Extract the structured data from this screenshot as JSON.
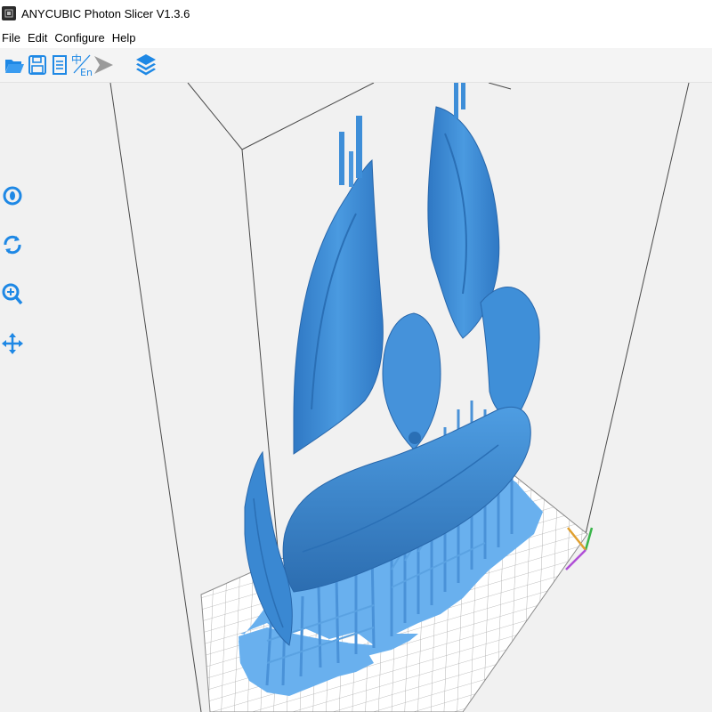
{
  "window": {
    "title": "ANYCUBIC Photon Slicer V1.3.6"
  },
  "menu": {
    "items": [
      {
        "label": "File"
      },
      {
        "label": "Edit"
      },
      {
        "label": "Configure"
      },
      {
        "label": "Help"
      }
    ]
  },
  "toolbar": {
    "buttons": [
      {
        "icon": "folder-open-icon"
      },
      {
        "icon": "save-icon"
      },
      {
        "icon": "document-icon"
      },
      {
        "icon": "language-icon",
        "label": "En"
      },
      {
        "icon": "slice-play-icon"
      },
      {
        "icon": "layers-icon"
      }
    ]
  },
  "view_controls": {
    "buttons": [
      {
        "icon": "eye-icon"
      },
      {
        "icon": "rotate-icon"
      },
      {
        "icon": "zoom-icon"
      },
      {
        "icon": "pan-move-icon"
      }
    ]
  },
  "colors": {
    "accent": "#1e88e5",
    "model": "#3e8ed8",
    "model_shadow": "#2a6fb5",
    "model_light": "#6fb0ea",
    "raft": "#6ab1ef",
    "grid": "#9a9a9a",
    "viewport_bg": "#f1f1f1",
    "axis_x": "#b04fd6",
    "axis_y": "#3ab54a",
    "axis_z": "#e0a030"
  }
}
